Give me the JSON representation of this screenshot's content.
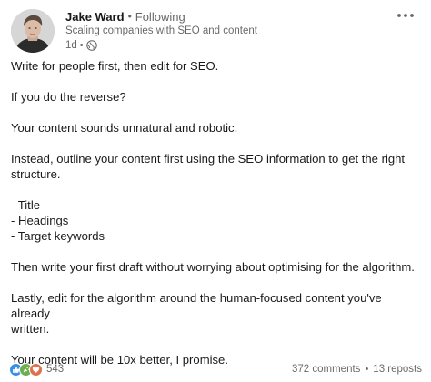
{
  "post": {
    "author": {
      "name": "Jake Ward",
      "follow_status": "Following",
      "headline": "Scaling companies with SEO and content",
      "time_ago": "1d",
      "separator": "•",
      "visibility_icon": "globe-icon"
    },
    "menu_icon": "more-horizontal-icon",
    "lines": [
      "Write for people first, then edit for SEO.",
      "",
      "If you do the reverse?",
      "",
      "Your content sounds unnatural and robotic.",
      "",
      "Instead, outline your content first using the SEO information to get the right",
      "structure.",
      "",
      "- Title",
      "- Headings",
      "- Target keywords",
      "",
      "Then write your first draft without worrying about optimising for the algorithm.",
      "",
      "Lastly, edit for the algorithm around the human-focused content you've already",
      "written.",
      "",
      "Your content will be 10x better, I promise."
    ]
  },
  "social": {
    "reaction_icons": [
      "like-icon",
      "celebrate-icon",
      "love-icon"
    ],
    "reaction_count": "543",
    "comments": "372 comments",
    "separator": "•",
    "reposts": "13 reposts"
  },
  "colors": {
    "like": "#378fe9",
    "celebrate": "#6dae4f",
    "love": "#df704d"
  }
}
